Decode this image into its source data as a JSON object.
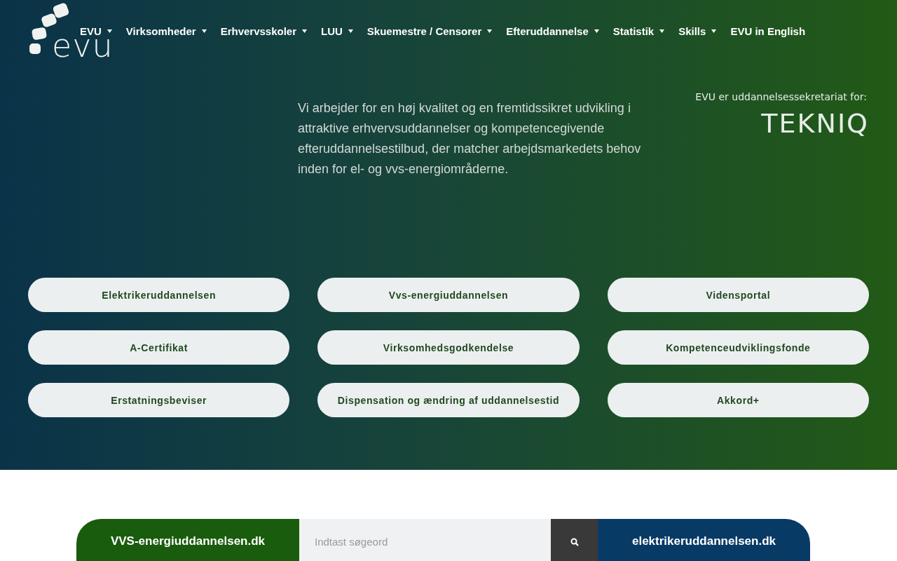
{
  "logo": {
    "text": "evu"
  },
  "nav": [
    {
      "label": "EVU",
      "dropdown": true
    },
    {
      "label": "Virksomheder",
      "dropdown": true
    },
    {
      "label": "Erhvervsskoler",
      "dropdown": true
    },
    {
      "label": "LUU",
      "dropdown": true
    },
    {
      "label": "Skuemestre / Censorer",
      "dropdown": true
    },
    {
      "label": "Efteruddannelse",
      "dropdown": true
    },
    {
      "label": "Statistik",
      "dropdown": true
    },
    {
      "label": "Skills",
      "dropdown": true
    },
    {
      "label": "EVU in English",
      "dropdown": false
    }
  ],
  "intro": "Vi arbejder for en høj kvalitet og en fremtidssikret udvikling i attraktive erhvervsuddannelser og kompetencegivende efteruddannelsestilbud, der matcher arbejdsmarkedets behov inden for el- og vvs-energiområderne.",
  "secretariat": {
    "text": "EVU er uddannelsessekretariat for:",
    "logo": "TEKNIQ"
  },
  "buttons": [
    "Elektrikeruddannelsen",
    "Vvs-energiuddannelsen",
    "Vidensportal",
    "A-Certifikat",
    "Virksomhedsgodkendelse",
    "Kompetenceudviklingsfonde",
    "Erstatningsbeviser",
    "Dispensation og ændring af uddannelsestid",
    "Akkord+"
  ],
  "search_bar": {
    "left_link": "VVS-energiuddannelsen.dk",
    "placeholder": "Indtast søgeord",
    "right_link": "elektrikeruddannelsen.dk"
  }
}
